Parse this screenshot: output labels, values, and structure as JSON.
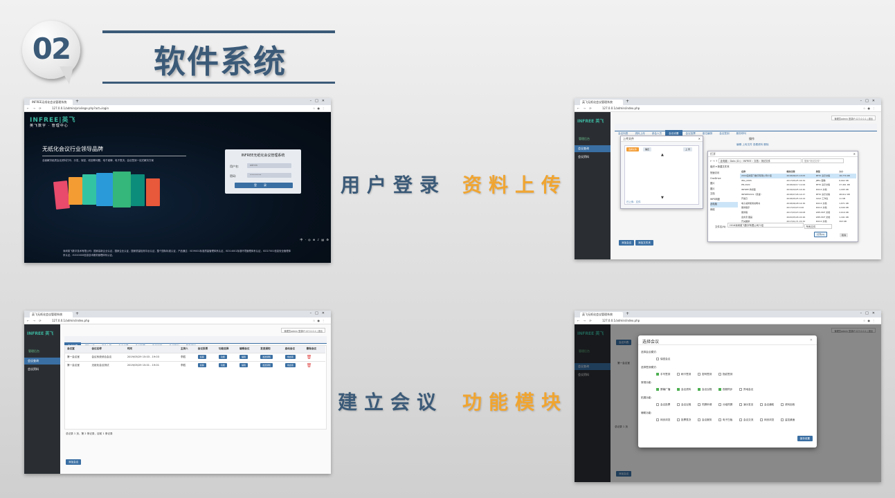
{
  "header": {
    "badge_number": "02",
    "title": "软件系统"
  },
  "captions": {
    "login": "用户登录",
    "upload": "资料上传",
    "create_meeting": "建立会议",
    "modules": "功能模块"
  },
  "colors": {
    "title_blue": "#3b5a78",
    "caption_gold": "#f0a531",
    "admin_accent": "#3a6fa3"
  },
  "shot_login": {
    "tab_title": "INFREE无纸化会议管理系统",
    "url": "127.0.0.1/admin/privilege.php?act=login",
    "logo": "INFREE|英飞",
    "logo_sub": "英飞数字 · 管理中心",
    "slogan": "无纸化会议行业领导品牌",
    "desc": "全面解决纸质会议资料打印、分发、保密、收回等问题，电子桌牌、电子表决、会议签到一站式解决方案",
    "login_title": "INFREE无纸化会议管理系统",
    "username_label": "用户名:",
    "username_value": "admin",
    "password_label": "密码:",
    "password_value": "••••••••",
    "login_button": "登录",
    "footer": "深圳英飞数字技术有限公司：国家高新企业认证，国家企业认证，国家质量检测平台认证，整个国际标准认证，产品通过：ISO9001标准质量管理体系认证，ISO14001标准环境管理体系认证，ISO27001信息安全管理体系认证，ISO20000信息技术服务管理体系认证。",
    "tray": "中 · ◎ ⊕ ♪ ▤ ⚙"
  },
  "shot_upload": {
    "tab_title": "英飞无纸化会议管理系统",
    "url": "127.0.0.1/admin/index.php",
    "side_logo": "INFREE 英飞",
    "side_title": "管理后台",
    "side_items": [
      "会议查询",
      "会议资料"
    ],
    "user_info": "管理员admin 登录IP:127.0.0.1 | 退出",
    "tabs": [
      "会议列表",
      "资料上传",
      "参会人员",
      "会议设置",
      "会议投票",
      "座位编排",
      "会议签到",
      "服务呼叫"
    ],
    "active_tab": 3,
    "upload_window_title": "上传文件",
    "upload_buttons": [
      "选择文件",
      "确定",
      "上 传"
    ],
    "upload_footer": "已上传：文件",
    "op_title": "操作",
    "op_links": "编辑  上传文件  查看资料  删除",
    "dialog_title": "打开",
    "dialog_path": "此电脑 › Data (D:) › INFREE › 文档 › 测试文件",
    "dialog_search": "搜索\"测试文件\"",
    "dialog_org": "组织 ▾     新建文件夹",
    "dialog_headers": [
      "名称",
      "修改日期",
      "类型",
      "大小"
    ],
    "dialog_tree": [
      "快速访问",
      "OneDrive",
      "图片",
      "图片",
      "文档",
      "WPS网盘",
      "此电脑",
      "网络"
    ],
    "dialog_files": [
      [
        "2016深圳英飞数字有限公司介绍",
        "2018/06/15 13:05",
        "PPTX 演示文稿",
        "18,779 KB"
      ],
      [
        "IMG_0065",
        "2017/05/25 16:34",
        "JPEG 图像",
        "6,602 KB"
      ],
      [
        "PB-2020",
        "2018/09/17 11:06",
        "PPTX 演示文稿",
        "27,461 KB"
      ],
      [
        "INFREE 商标图",
        "2019/04/25 14:40",
        "DOCX 文档",
        "1,095 KB"
      ],
      [
        "INFREE2019（英语）",
        "2018/07/26 14:47",
        "PPTX 演示文稿",
        "48,612 KB"
      ],
      [
        "开发日",
        "2018/05/25 14:24",
        "XLSX 工作表",
        "11 KB"
      ],
      [
        "电子桌牌使用说明书",
        "2018/06/28 14:36",
        "DOCX 文档",
        "1,871 KB"
      ],
      [
        "服务程序",
        "2017/03/23 9:20",
        "DOCX 文档",
        "4,949 KB"
      ],
      [
        "服务程",
        "2017/03/23 16:08",
        "WPS PDF 文档",
        "2,619 KB"
      ],
      [
        "会务流 图画",
        "2020/05/26 22:46",
        "WPS PDF 文档",
        "1,441 KB"
      ],
      [
        "开关翻译",
        "2017/01/71 15:32",
        "DOCX 文档",
        "393 KB"
      ]
    ],
    "dialog_filename_label": "文件名(N):",
    "dialog_filename": "2016深圳英飞数字有限公司介绍",
    "dialog_type": "所有文件",
    "dialog_open": "打开(O)",
    "dialog_cancel": "取消",
    "bottom_buttons": [
      "添加会议",
      "添加文件夹"
    ]
  },
  "shot_meeting": {
    "tab_title": "英飞无纸化会议管理系统",
    "url": "127.0.0.1/admin/index.php",
    "side_logo": "INFREE 英飞",
    "side_title": "管理后台",
    "side_items": [
      "会议查询",
      "会议资料"
    ],
    "user_info": "管理员admin 登录IP:127.0.0.1 | 退出",
    "tabs": [
      "会议列表",
      "资料上传",
      "参会人员",
      "会议设置",
      "会议投票",
      "座位编排",
      "会议签到",
      "服务呼叫"
    ],
    "active_tab": 0,
    "headers": [
      "会议室",
      "会议名称",
      "时间",
      "主持人",
      "会议投票",
      "功能选择",
      "编辑会议",
      "发送通知",
      "启动会议",
      "删除会议"
    ],
    "rows": [
      {
        "room": "第一会议室",
        "name": "会议系统综合会议",
        "time": "2019/05/29 15:03 - 19:03",
        "host": "李胜",
        "btns": [
          "投票",
          "功能",
          "编辑",
          "发送通知",
          "未启用"
        ]
      },
      {
        "room": "第一会议室",
        "name": "无纸化会议测试",
        "time": "2019/05/29 15:01 - 19:01",
        "host": "李胜",
        "btns": [
          "投票",
          "功能",
          "编辑",
          "发送通知",
          "未启用"
        ]
      }
    ],
    "pagination": "总记录 1 页，第 2 条记录，目前 1 条记录",
    "add_button": "添加会议"
  },
  "shot_modules": {
    "tab_title": "英飞无纸化会议管理系统",
    "url": "127.0.0.1/admin/index.php",
    "side_logo": "INFREE 英飞",
    "side_title": "管理后台",
    "side_items": [
      "会议查询",
      "会议资料"
    ],
    "user_info": "管理员admin 登录IP:127.0.0.1 | 退出",
    "bg_tab": "会议列表",
    "bg_room": "第一会议室",
    "bg_pagination": "总记录 1 页",
    "bg_add": "添加会议",
    "modal_title": "选择会议",
    "mode_label": "选择会议模式:",
    "mode_options": [
      {
        "label": "保密会议",
        "on": false
      }
    ],
    "sign_label": "选择签到模式:",
    "sign_options": [
      {
        "label": "手写签到",
        "on": true
      },
      {
        "label": "刷卡签到",
        "on": false
      },
      {
        "label": "密码签到",
        "on": false
      },
      {
        "label": "指纹签到",
        "on": false
      }
    ],
    "common_label": "常规功能:",
    "common_options": [
      {
        "label": "屏幕广播",
        "on": true
      },
      {
        "label": "会议资料",
        "on": true
      },
      {
        "label": "会议议程",
        "on": true
      },
      {
        "label": "视频同步",
        "on": true
      },
      {
        "label": "异地会议",
        "on": false
      }
    ],
    "extend_label": "拓展功能:",
    "extend_options": [
      {
        "label": "会议投票",
        "on": false
      },
      {
        "label": "会议议程",
        "on": false
      },
      {
        "label": "同屏申请",
        "on": false
      },
      {
        "label": "分组同屏",
        "on": false
      },
      {
        "label": "演示发言",
        "on": false
      },
      {
        "label": "会议通知",
        "on": false
      },
      {
        "label": "资料回收",
        "on": false
      }
    ],
    "assist_label": "辅助功能:",
    "assist_options": [
      {
        "label": "网页浏览",
        "on": false
      },
      {
        "label": "投票表决",
        "on": false
      },
      {
        "label": "会议服务",
        "on": false
      },
      {
        "label": "电子白板",
        "on": false
      },
      {
        "label": "会议交流",
        "on": false
      },
      {
        "label": "网页浏览",
        "on": false
      },
      {
        "label": "监控桌面",
        "on": false
      }
    ],
    "save_button": "保存设置"
  }
}
